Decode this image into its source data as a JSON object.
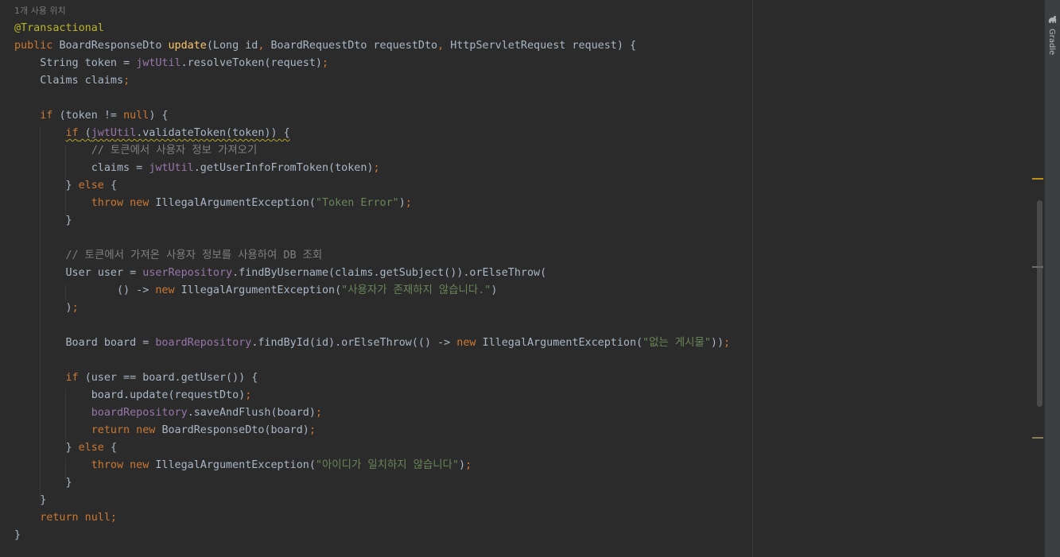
{
  "editor": {
    "usage_hint": "1개 사용 위치",
    "lines": [
      [
        [
          "ann",
          "@Transactional"
        ]
      ],
      [
        [
          "kw",
          "public "
        ],
        [
          "",
          "BoardResponseDto "
        ],
        [
          "fn",
          "update"
        ],
        [
          "",
          "(Long id"
        ],
        [
          "kw",
          ", "
        ],
        [
          "",
          "BoardRequestDto requestDto"
        ],
        [
          "kw",
          ", "
        ],
        [
          "",
          "HttpServletRequest request) {"
        ]
      ],
      [
        [
          "",
          "    String token = "
        ],
        [
          "fld",
          "jwtUtil"
        ],
        [
          "",
          ".resolveToken(request)"
        ],
        [
          "kw",
          ";"
        ]
      ],
      [
        [
          "",
          "    Claims claims"
        ],
        [
          "kw",
          ";"
        ]
      ],
      [],
      [
        [
          "",
          "    "
        ],
        [
          "kw",
          "if "
        ],
        [
          "",
          "(token != "
        ],
        [
          "kw",
          "null"
        ],
        [
          "",
          ") {"
        ]
      ],
      [
        [
          "",
          "        "
        ],
        [
          "kw warn",
          "if"
        ],
        [
          "warn",
          " ("
        ],
        [
          "fld warn",
          "jwtUtil"
        ],
        [
          "warn",
          ".validateToken(token)) {"
        ]
      ],
      [
        [
          "",
          "            "
        ],
        [
          "cmt",
          "// 토큰에서 사용자 정보 가져오기"
        ]
      ],
      [
        [
          "",
          "            claims = "
        ],
        [
          "fld",
          "jwtUtil"
        ],
        [
          "",
          ".getUserInfoFromToken(token)"
        ],
        [
          "kw",
          ";"
        ]
      ],
      [
        [
          "",
          "        } "
        ],
        [
          "kw",
          "else "
        ],
        [
          "",
          "{"
        ]
      ],
      [
        [
          "",
          "            "
        ],
        [
          "kw",
          "throw new "
        ],
        [
          "",
          "IllegalArgumentException("
        ],
        [
          "str",
          "\"Token Error\""
        ],
        [
          "",
          ")"
        ],
        [
          "kw",
          ";"
        ]
      ],
      [
        [
          "",
          "        }"
        ]
      ],
      [],
      [
        [
          "",
          "        "
        ],
        [
          "cmt",
          "// 토큰에서 가져온 사용자 정보를 사용하여 DB 조회"
        ]
      ],
      [
        [
          "",
          "        User user = "
        ],
        [
          "fld",
          "userRepository"
        ],
        [
          "",
          ".findByUsername(claims.getSubject()).orElseThrow("
        ]
      ],
      [
        [
          "",
          "                () -> "
        ],
        [
          "kw",
          "new "
        ],
        [
          "",
          "IllegalArgumentException("
        ],
        [
          "str",
          "\"사용자가 존재하지 않습니다.\""
        ],
        [
          "",
          ")"
        ]
      ],
      [
        [
          "",
          "        )"
        ],
        [
          "kw",
          ";"
        ]
      ],
      [],
      [
        [
          "",
          "        Board board = "
        ],
        [
          "fld",
          "boardRepository"
        ],
        [
          "",
          ".findById(id).orElseThrow(() -> "
        ],
        [
          "kw",
          "new "
        ],
        [
          "",
          "IllegalArgumentException("
        ],
        [
          "str",
          "\"없는 게시물\""
        ],
        [
          "",
          "))"
        ],
        [
          "kw",
          ";"
        ]
      ],
      [],
      [
        [
          "",
          "        "
        ],
        [
          "kw",
          "if "
        ],
        [
          "",
          "(user == board.getUser()) {"
        ]
      ],
      [
        [
          "",
          "            board.update(requestDto)"
        ],
        [
          "kw",
          ";"
        ]
      ],
      [
        [
          "",
          "            "
        ],
        [
          "fld",
          "boardRepository"
        ],
        [
          "",
          ".saveAndFlush(board)"
        ],
        [
          "kw",
          ";"
        ]
      ],
      [
        [
          "",
          "            "
        ],
        [
          "kw",
          "return new "
        ],
        [
          "",
          "BoardResponseDto(board)"
        ],
        [
          "kw",
          ";"
        ]
      ],
      [
        [
          "",
          "        } "
        ],
        [
          "kw",
          "else "
        ],
        [
          "",
          "{"
        ]
      ],
      [
        [
          "",
          "            "
        ],
        [
          "kw",
          "throw new "
        ],
        [
          "",
          "IllegalArgumentException("
        ],
        [
          "str",
          "\"아이디가 일치하지 않습니다\""
        ],
        [
          "",
          ")"
        ],
        [
          "kw",
          ";"
        ]
      ],
      [
        [
          "",
          "        }"
        ]
      ],
      [
        [
          "",
          "    }"
        ]
      ],
      [
        [
          "",
          "    "
        ],
        [
          "kw",
          "return null;"
        ]
      ],
      [
        [
          "",
          "}"
        ]
      ]
    ]
  },
  "right_panel": {
    "gradle_label": "Gradle",
    "gradle_icon": "gradle-elephant-icon"
  },
  "colors": {
    "background": "#2b2b2b",
    "keyword": "#cc7832",
    "annotation": "#bbb529",
    "method": "#ffc66d",
    "field": "#9876aa",
    "string": "#6a8759",
    "comment": "#808080",
    "default": "#a9b7c6"
  }
}
